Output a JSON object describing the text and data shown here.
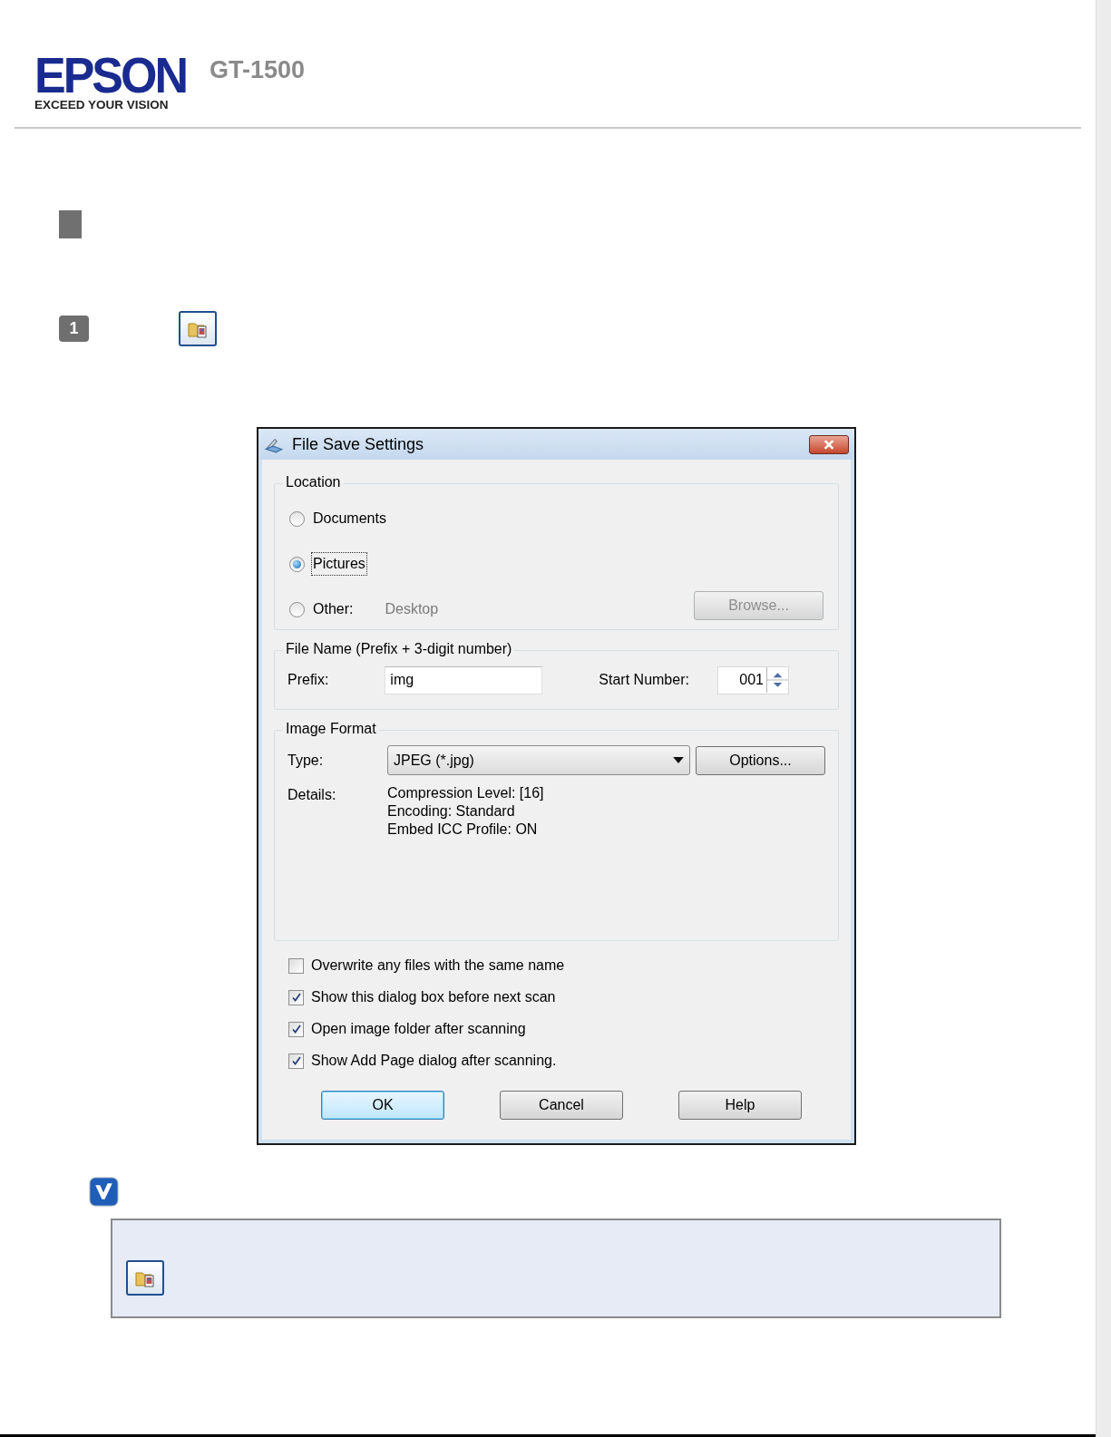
{
  "header": {
    "brand": "EPSON",
    "tagline": "EXCEED YOUR VISION",
    "model": "GT-1500"
  },
  "step": {
    "number": "1"
  },
  "dialog": {
    "title": "File Save Settings",
    "location": {
      "legend": "Location",
      "options": [
        {
          "label": "Documents",
          "selected": false,
          "focused": false
        },
        {
          "label": "Pictures",
          "selected": true,
          "focused": true
        },
        {
          "label": "Other:",
          "selected": false,
          "focused": false
        }
      ],
      "other_value": "Desktop",
      "browse": {
        "label": "Browse...",
        "disabled": true
      }
    },
    "file_name": {
      "legend": "File Name (Prefix + 3-digit number)",
      "prefix_label": "Prefix:",
      "prefix_value": "img",
      "start_label": "Start Number:",
      "start_value": "001"
    },
    "image_format": {
      "legend": "Image Format",
      "type_label": "Type:",
      "type_value": "JPEG (*.jpg)",
      "options_button": "Options...",
      "details_label": "Details:",
      "details": [
        "Compression Level: [16]",
        "Encoding: Standard",
        "Embed ICC Profile: ON"
      ]
    },
    "checkboxes": [
      {
        "label": "Overwrite any files with the same name",
        "checked": false
      },
      {
        "label": "Show this dialog box before next scan",
        "checked": true
      },
      {
        "label": "Open image folder after scanning",
        "checked": true
      },
      {
        "label": "Show Add Page dialog after scanning.",
        "checked": true
      }
    ],
    "buttons": [
      {
        "label": "OK",
        "default": true
      },
      {
        "label": "Cancel",
        "default": false
      },
      {
        "label": "Help",
        "default": false
      }
    ]
  }
}
